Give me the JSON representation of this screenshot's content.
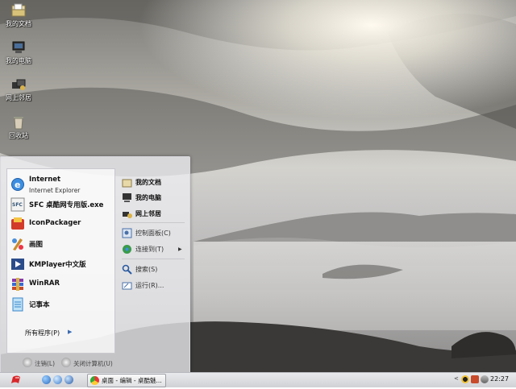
{
  "desktop": {
    "icons": [
      {
        "label": "我的文档",
        "icon": "my-documents-icon"
      },
      {
        "label": "我的电脑",
        "icon": "my-computer-icon"
      },
      {
        "label": "网上邻居",
        "icon": "network-places-icon"
      },
      {
        "label": "回收站",
        "icon": "recycle-bin-icon"
      }
    ]
  },
  "start_menu": {
    "programs": [
      {
        "title": "Internet",
        "subtitle": "Internet Explorer",
        "icon": "internet-explorer-icon"
      },
      {
        "title": "SFC 桌酷网专用版.exe",
        "icon": "sfc-app-icon"
      },
      {
        "title": "IconPackager",
        "icon": "iconpackager-icon"
      },
      {
        "title": "画图",
        "icon": "paint-icon"
      },
      {
        "title": "KMPlayer中文版",
        "icon": "kmplayer-icon"
      },
      {
        "title": "WinRAR",
        "icon": "winrar-icon"
      },
      {
        "title": "记事本",
        "icon": "notepad-icon"
      }
    ],
    "all_programs": "所有程序(P)",
    "places": [
      {
        "label": "我的文档",
        "icon": "my-documents-icon"
      },
      {
        "label": "我的电脑",
        "icon": "my-computer-icon"
      },
      {
        "label": "网上邻居",
        "icon": "network-places-icon"
      },
      {
        "label": "控制面板(C)",
        "icon": "control-panel-icon"
      },
      {
        "label": "连接到(T)",
        "icon": "connect-to-icon"
      },
      {
        "label": "搜索(S)",
        "icon": "search-icon"
      },
      {
        "label": "运行(R)...",
        "icon": "run-icon"
      }
    ],
    "logoff": "注销(L)",
    "shutdown": "关闭计算机(U)"
  },
  "taskbar": {
    "task_button": "桌面 - 编辑 - 桌酷魅...",
    "clock": "22:27"
  },
  "colors": {
    "accent": "#3a6ab0",
    "menu_bg": "#ececf0"
  }
}
